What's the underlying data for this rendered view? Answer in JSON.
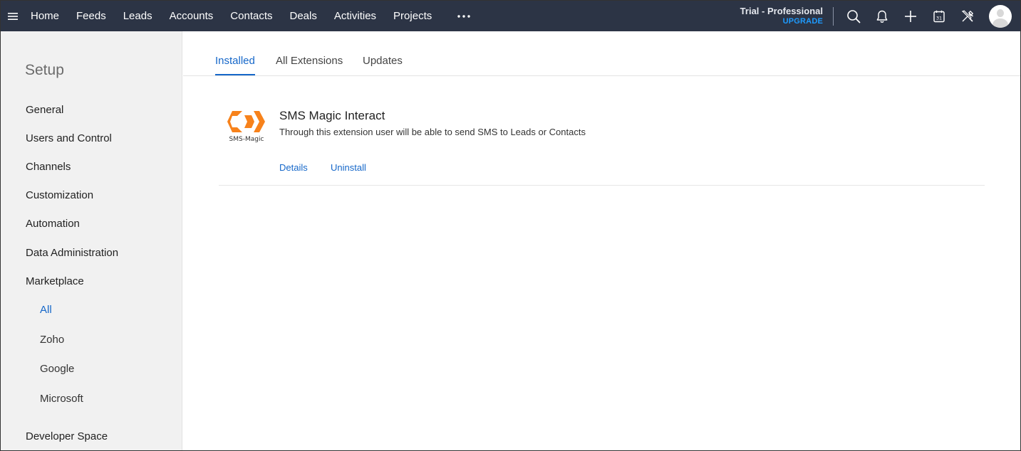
{
  "topnav": {
    "items": [
      "Home",
      "Feeds",
      "Leads",
      "Accounts",
      "Contacts",
      "Deals",
      "Activities",
      "Projects"
    ],
    "more_label": "•••",
    "trial_title": "Trial - Professional",
    "upgrade_label": "UPGRADE",
    "icons": [
      "search-icon",
      "bell-icon",
      "plus-icon",
      "calendar-icon",
      "tools-icon"
    ],
    "calendar_day": "31"
  },
  "sidebar": {
    "title": "Setup",
    "items": [
      "General",
      "Users and Control",
      "Channels",
      "Customization",
      "Automation",
      "Data Administration",
      "Marketplace"
    ],
    "marketplace_subitems": [
      "All",
      "Zoho",
      "Google",
      "Microsoft"
    ],
    "active_subitem": "All",
    "last_item": "Developer Space"
  },
  "tabs": [
    "Installed",
    "All Extensions",
    "Updates"
  ],
  "active_tab": "Installed",
  "extension": {
    "logo_text": "SMS-Magic",
    "name": "SMS Magic Interact",
    "description": "Through this extension user will be able to send SMS to Leads or Contacts",
    "details_label": "Details",
    "uninstall_label": "Uninstall"
  },
  "colors": {
    "topbar_bg": "#2c3445",
    "accent": "#1567c9",
    "upgrade": "#1e9bff",
    "logo_orange": "#f7821b"
  }
}
